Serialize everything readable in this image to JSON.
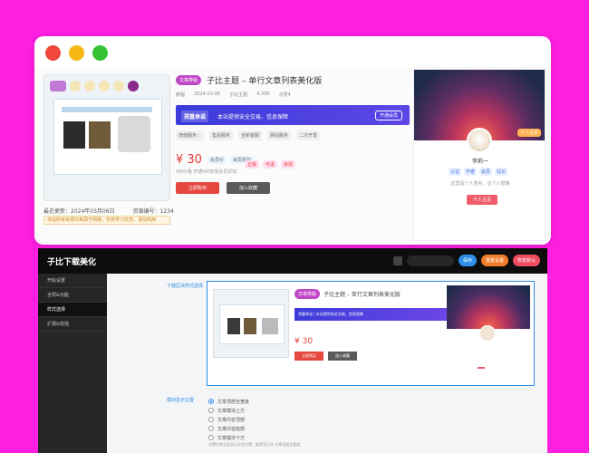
{
  "top": {
    "product": {
      "stats": [
        "最近更新：2024年03月06日",
        "资源编号：1234"
      ],
      "warn": "本站所有资源均来源于网络，仅供学习交流，请勿商用",
      "tag": "文章排版",
      "title": "子比主题 – 单行文章列表美化版",
      "meta": [
        "教程",
        "2024-03-06",
        "子比主题",
        "4.33K",
        "点赞4"
      ],
      "banner": {
        "name": "郑重承诺",
        "text": "本站提供安全交易、信息保障",
        "button": "开通会员"
      },
      "features": [
        "增值服务：",
        "售后服务",
        "全新客服",
        "网站服务",
        "二次开发"
      ],
      "price": "¥ 30",
      "price_badges": [
        "会员价",
        "会员折扣"
      ],
      "subline": "VIP价格  开通VIP享受会员折扣",
      "pills": [
        "正版",
        "可退",
        "资源"
      ],
      "buy": "立即购买",
      "fav": "加入收藏"
    },
    "author": {
      "cover_tag": "个人主页",
      "name": "李莉一",
      "tags": [
        "认证",
        "作者",
        "会员",
        "站长"
      ],
      "desc": "这里是个人签名，这个人很懒",
      "button": "个人主页"
    }
  },
  "admin": {
    "title": "子比下载美化",
    "actions": [
      "保存",
      "重置设置",
      "恢复默认"
    ],
    "sidebar": [
      "开始设置",
      "全局&功能",
      "样式选择",
      "扩展&增强"
    ],
    "label1": "下载区块样式选择",
    "label2": "模块显示位置",
    "preview": {
      "tag": "文章排版",
      "title": "子比主题 – 单行文章列表美化版",
      "banner": "郑重承诺 | 本站提供安全交易、信息保障",
      "price": "¥ 30",
      "buy": "立即购买",
      "fav": "加入收藏"
    },
    "radios": [
      "文章顶部全宽度",
      "文章模块上方",
      "文章内容顶部",
      "文章内容底部",
      "文章模块下方"
    ],
    "radio_selected": 0,
    "hint": "设置后将全局显示在此位置，推荐显示在 文章顶部全宽度"
  }
}
